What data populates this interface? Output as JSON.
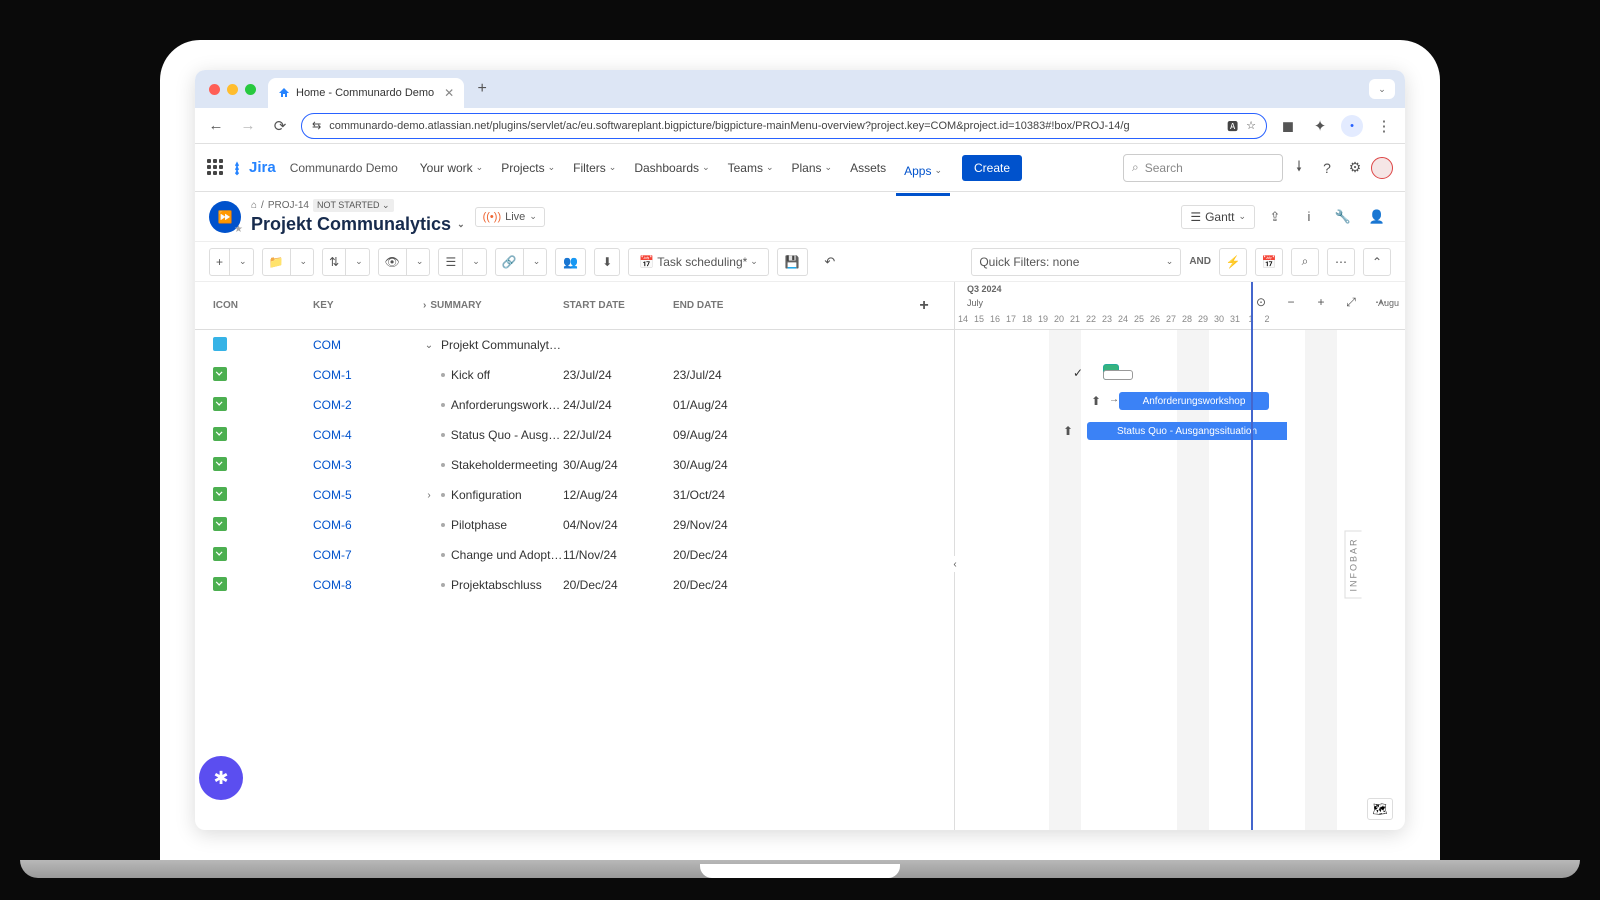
{
  "browser": {
    "tab_title": "Home - Communardo Demo",
    "url": "communardo-demo.atlassian.net/plugins/servlet/ac/eu.softwareplant.bigpicture/bigpicture-mainMenu-overview?project.key=COM&project.id=10383#!box/PROJ-14/g"
  },
  "jira": {
    "site": "Communardo Demo",
    "nav": [
      "Your work",
      "Projects",
      "Filters",
      "Dashboards",
      "Teams",
      "Plans",
      "Assets",
      "Apps"
    ],
    "create": "Create",
    "search_placeholder": "Search"
  },
  "header": {
    "crumb_proj": "PROJ-14",
    "status": "NOT STARTED",
    "title": "Projekt Communalytics",
    "live": "Live",
    "gantt": "Gantt"
  },
  "toolbar": {
    "task": "Task scheduling*",
    "filter": "Quick Filters: none",
    "and": "AND"
  },
  "columns": {
    "icon": "ICON",
    "key": "KEY",
    "summary": "SUMMARY",
    "start": "START DATE",
    "end": "END DATE"
  },
  "rows": [
    {
      "icon": "proj",
      "key": "COM",
      "summary": "Projekt Communalytics",
      "start": "",
      "end": "",
      "chev": "down"
    },
    {
      "icon": "task",
      "key": "COM-1",
      "summary": "Kick off",
      "start": "23/Jul/24",
      "end": "23/Jul/24"
    },
    {
      "icon": "task",
      "key": "COM-2",
      "summary": "Anforderungsworks...",
      "start": "24/Jul/24",
      "end": "01/Aug/24"
    },
    {
      "icon": "task",
      "key": "COM-4",
      "summary": "Status Quo - Ausga...",
      "start": "22/Jul/24",
      "end": "09/Aug/24"
    },
    {
      "icon": "task",
      "key": "COM-3",
      "summary": "Stakeholdermeeting",
      "start": "30/Aug/24",
      "end": "30/Aug/24"
    },
    {
      "icon": "task",
      "key": "COM-5",
      "summary": "Konfiguration",
      "start": "12/Aug/24",
      "end": "31/Oct/24",
      "chev": "right"
    },
    {
      "icon": "task",
      "key": "COM-6",
      "summary": "Pilotphase",
      "start": "04/Nov/24",
      "end": "29/Nov/24"
    },
    {
      "icon": "task",
      "key": "COM-7",
      "summary": "Change und Adopti...",
      "start": "11/Nov/24",
      "end": "20/Dec/24"
    },
    {
      "icon": "task",
      "key": "COM-8",
      "summary": "Projektabschluss",
      "start": "20/Dec/24",
      "end": "20/Dec/24"
    }
  ],
  "timeline": {
    "quarter": "Q3 2024",
    "month1": "July",
    "month2": "Augu",
    "days": [
      "14",
      "15",
      "16",
      "17",
      "18",
      "19",
      "20",
      "21",
      "22",
      "23",
      "24",
      "25",
      "26",
      "27",
      "28",
      "29",
      "30",
      "31",
      "1",
      "2"
    ],
    "bar2": "Anforderungsworkshop",
    "bar3": "Status Quo - Ausgangssituation"
  },
  "infobar": "INFOBAR"
}
